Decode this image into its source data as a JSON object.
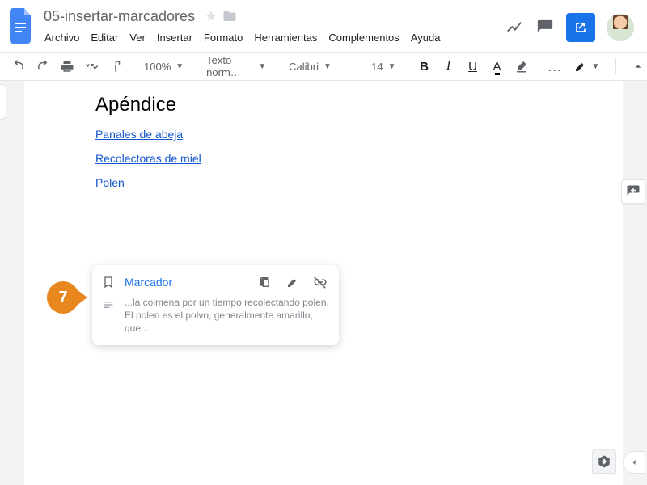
{
  "header": {
    "doc_title": "05-insertar-marcadores",
    "menus": [
      "Archivo",
      "Editar",
      "Ver",
      "Insertar",
      "Formato",
      "Herramientas",
      "Complementos",
      "Ayuda"
    ]
  },
  "toolbar": {
    "zoom": "100%",
    "style": "Texto norm…",
    "font": "Calibri",
    "font_size": "14",
    "bold": "B",
    "italic": "I",
    "underline": "U",
    "textcolor": "A",
    "more": "…"
  },
  "document": {
    "heading": "Apéndice",
    "links": [
      "Panales de abeja",
      "Recolectoras de miel",
      "Polen"
    ]
  },
  "popover": {
    "label": "Marcador",
    "snippet": "...la colmena por un tiempo recolectando polen. El polen es el polvo, generalmente amarillo, que..."
  },
  "step_badge": "7"
}
